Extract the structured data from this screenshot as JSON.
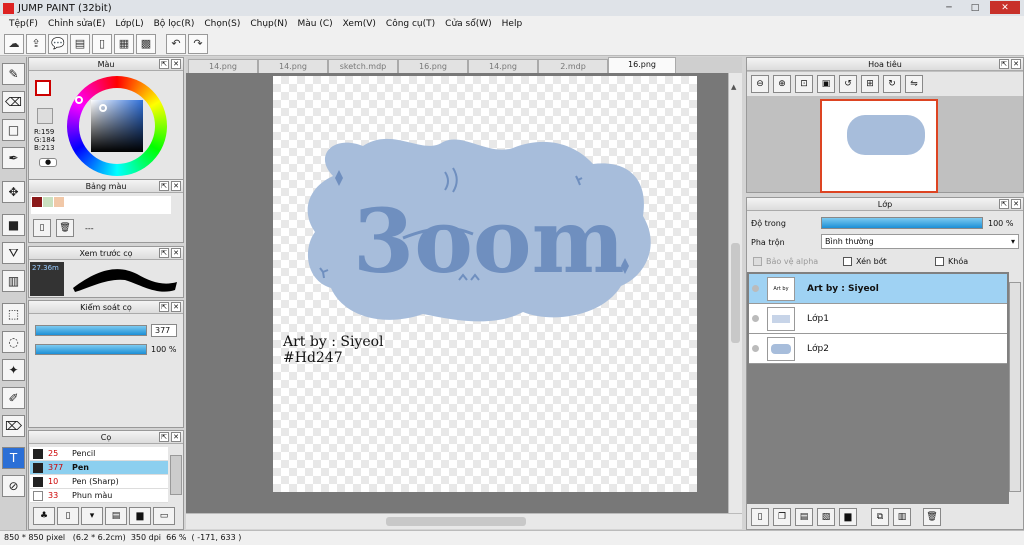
{
  "window": {
    "title": "JUMP PAINT (32bit)",
    "minimize": "─",
    "maximize": "□",
    "close": "✕"
  },
  "menu": [
    "Tệp(F)",
    "Chỉnh sửa(E)",
    "Lớp(L)",
    "Bộ lọc(R)",
    "Chọn(S)",
    "Chụp(N)",
    "Màu (C)",
    "Xem(V)",
    "Công cụ(T)",
    "Cửa sổ(W)",
    "Help"
  ],
  "toolbar_icons": [
    "cloud-icon",
    "share-icon",
    "chat-icon",
    "comment-icon",
    "page-icon",
    "grid-icon",
    "layout-icon",
    "undo-icon",
    "redo-icon"
  ],
  "panels": {
    "color": {
      "title": "Màu",
      "r": "R:159",
      "g": "G:184",
      "b": "B:213"
    },
    "palette": {
      "title": "Bảng màu",
      "value": "---",
      "colors": [
        "#8b1a1a",
        "#c9e0c0",
        "#f1c8a8"
      ]
    },
    "brush_preview": {
      "title": "Xem trước cọ",
      "size": "27.36m"
    },
    "brush_control": {
      "title": "Kiểm soát cọ",
      "size": "377",
      "opacity": "100 %"
    },
    "brushes": {
      "title": "Cọ",
      "items": [
        {
          "size": "25",
          "name": "Pencil",
          "selected": false
        },
        {
          "size": "377",
          "name": "Pen",
          "selected": true
        },
        {
          "size": "10",
          "name": "Pen (Sharp)",
          "selected": false
        },
        {
          "size": "33",
          "name": "Phun màu",
          "selected": false
        }
      ]
    }
  },
  "tabs": [
    "14.png",
    "14.png",
    "sketch.mdp",
    "16.png",
    "14.png",
    "2.mdp",
    "16.png"
  ],
  "active_tab": 6,
  "canvas": {
    "logo_text": "3oom",
    "caption_line1": "Art by : Siyeol",
    "caption_line2": "#Hd247",
    "blob_color": "#a7bddb",
    "ink_color": "#6f8fbf"
  },
  "navigator": {
    "title": "Hoa tiêu"
  },
  "layers": {
    "title": "Lớp",
    "opacity_label": "Độ trong",
    "opacity_value": "100 %",
    "blend_label": "Pha trộn",
    "blend_value": "Bình thường",
    "protect_alpha": "Bảo vệ alpha",
    "clipping": "Xén bớt",
    "lock": "Khóa",
    "items": [
      {
        "name": "Art by : Siyeol",
        "selected": true
      },
      {
        "name": "Lớp1",
        "selected": false
      },
      {
        "name": "Lớp2",
        "selected": false
      }
    ]
  },
  "status": {
    "size": "850 * 850 pixel",
    "cm": "(6.2 * 6.2cm)",
    "dpi": "350 dpi",
    "zoom": "66 %",
    "coords": "( -171, 633 )"
  }
}
